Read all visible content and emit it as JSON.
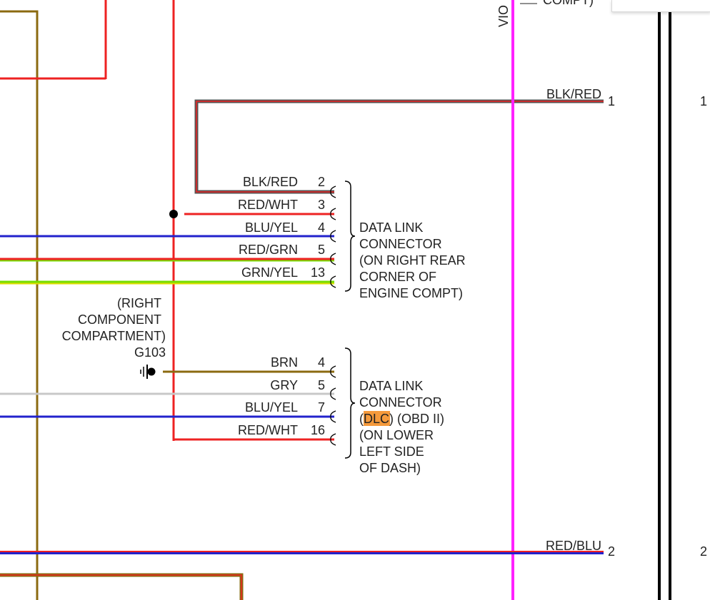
{
  "colors": {
    "red": "#ee2222",
    "brown": "#8b6a10",
    "blue": "#2222cc",
    "green": "#77dd00",
    "gray": "#c8c8c8",
    "dark_gray": "#555555",
    "violet": "#ff22ff",
    "black": "#000000",
    "highlight": "#f59a3c"
  },
  "top": {
    "vio_label": "VIO",
    "cut_text": "COMPT)"
  },
  "right_wires": [
    {
      "label": "BLK/RED",
      "pin": "1",
      "far_pin": "1"
    },
    {
      "label": "RED/BLU",
      "pin": "2",
      "far_pin": "2"
    }
  ],
  "upper_connector": {
    "pins": [
      {
        "wire": "BLK/RED",
        "pin": "2"
      },
      {
        "wire": "RED/WHT",
        "pin": "3"
      },
      {
        "wire": "BLU/YEL",
        "pin": "4"
      },
      {
        "wire": "RED/GRN",
        "pin": "5"
      },
      {
        "wire": "GRN/YEL",
        "pin": "13"
      }
    ],
    "desc": [
      "DATA LINK",
      "CONNECTOR",
      "(ON RIGHT REAR",
      "CORNER OF",
      "ENGINE COMPT)"
    ]
  },
  "ground": {
    "location": [
      "(RIGHT",
      "COMPONENT",
      "COMPARTMENT)"
    ],
    "id": "G103"
  },
  "lower_connector": {
    "pins": [
      {
        "wire": "BRN",
        "pin": "4"
      },
      {
        "wire": "GRY",
        "pin": "5"
      },
      {
        "wire": "BLU/YEL",
        "pin": "7"
      },
      {
        "wire": "RED/WHT",
        "pin": "16"
      }
    ],
    "desc_line1": "DATA LINK",
    "desc_line2": "CONNECTOR",
    "desc_open_paren": "(",
    "desc_highlight": "DLC",
    "desc_rest": ") (OBD II)",
    "desc_more": [
      "(ON LOWER",
      "LEFT SIDE",
      "OF DASH)"
    ]
  }
}
